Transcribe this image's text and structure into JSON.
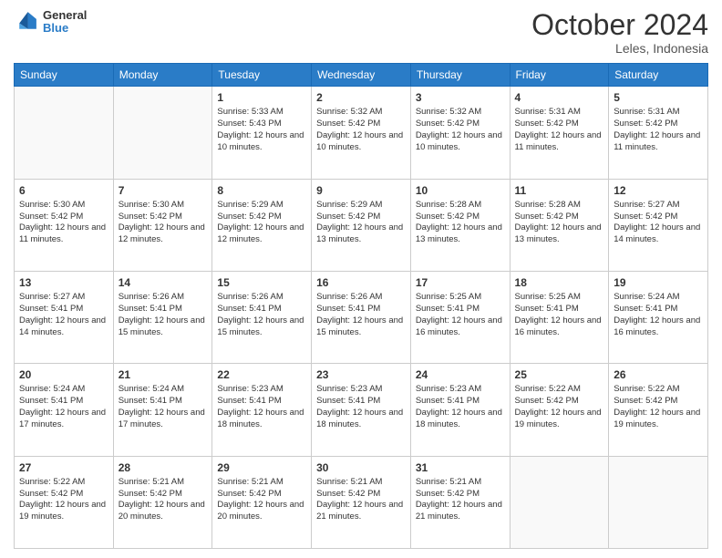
{
  "header": {
    "logo_line1": "General",
    "logo_line2": "Blue",
    "title": "October 2024",
    "subtitle": "Leles, Indonesia"
  },
  "days_of_week": [
    "Sunday",
    "Monday",
    "Tuesday",
    "Wednesday",
    "Thursday",
    "Friday",
    "Saturday"
  ],
  "weeks": [
    [
      {
        "day": "",
        "info": ""
      },
      {
        "day": "",
        "info": ""
      },
      {
        "day": "1",
        "info": "Sunrise: 5:33 AM\nSunset: 5:43 PM\nDaylight: 12 hours and 10 minutes."
      },
      {
        "day": "2",
        "info": "Sunrise: 5:32 AM\nSunset: 5:42 PM\nDaylight: 12 hours and 10 minutes."
      },
      {
        "day": "3",
        "info": "Sunrise: 5:32 AM\nSunset: 5:42 PM\nDaylight: 12 hours and 10 minutes."
      },
      {
        "day": "4",
        "info": "Sunrise: 5:31 AM\nSunset: 5:42 PM\nDaylight: 12 hours and 11 minutes."
      },
      {
        "day": "5",
        "info": "Sunrise: 5:31 AM\nSunset: 5:42 PM\nDaylight: 12 hours and 11 minutes."
      }
    ],
    [
      {
        "day": "6",
        "info": "Sunrise: 5:30 AM\nSunset: 5:42 PM\nDaylight: 12 hours and 11 minutes."
      },
      {
        "day": "7",
        "info": "Sunrise: 5:30 AM\nSunset: 5:42 PM\nDaylight: 12 hours and 12 minutes."
      },
      {
        "day": "8",
        "info": "Sunrise: 5:29 AM\nSunset: 5:42 PM\nDaylight: 12 hours and 12 minutes."
      },
      {
        "day": "9",
        "info": "Sunrise: 5:29 AM\nSunset: 5:42 PM\nDaylight: 12 hours and 13 minutes."
      },
      {
        "day": "10",
        "info": "Sunrise: 5:28 AM\nSunset: 5:42 PM\nDaylight: 12 hours and 13 minutes."
      },
      {
        "day": "11",
        "info": "Sunrise: 5:28 AM\nSunset: 5:42 PM\nDaylight: 12 hours and 13 minutes."
      },
      {
        "day": "12",
        "info": "Sunrise: 5:27 AM\nSunset: 5:42 PM\nDaylight: 12 hours and 14 minutes."
      }
    ],
    [
      {
        "day": "13",
        "info": "Sunrise: 5:27 AM\nSunset: 5:41 PM\nDaylight: 12 hours and 14 minutes."
      },
      {
        "day": "14",
        "info": "Sunrise: 5:26 AM\nSunset: 5:41 PM\nDaylight: 12 hours and 15 minutes."
      },
      {
        "day": "15",
        "info": "Sunrise: 5:26 AM\nSunset: 5:41 PM\nDaylight: 12 hours and 15 minutes."
      },
      {
        "day": "16",
        "info": "Sunrise: 5:26 AM\nSunset: 5:41 PM\nDaylight: 12 hours and 15 minutes."
      },
      {
        "day": "17",
        "info": "Sunrise: 5:25 AM\nSunset: 5:41 PM\nDaylight: 12 hours and 16 minutes."
      },
      {
        "day": "18",
        "info": "Sunrise: 5:25 AM\nSunset: 5:41 PM\nDaylight: 12 hours and 16 minutes."
      },
      {
        "day": "19",
        "info": "Sunrise: 5:24 AM\nSunset: 5:41 PM\nDaylight: 12 hours and 16 minutes."
      }
    ],
    [
      {
        "day": "20",
        "info": "Sunrise: 5:24 AM\nSunset: 5:41 PM\nDaylight: 12 hours and 17 minutes."
      },
      {
        "day": "21",
        "info": "Sunrise: 5:24 AM\nSunset: 5:41 PM\nDaylight: 12 hours and 17 minutes."
      },
      {
        "day": "22",
        "info": "Sunrise: 5:23 AM\nSunset: 5:41 PM\nDaylight: 12 hours and 18 minutes."
      },
      {
        "day": "23",
        "info": "Sunrise: 5:23 AM\nSunset: 5:41 PM\nDaylight: 12 hours and 18 minutes."
      },
      {
        "day": "24",
        "info": "Sunrise: 5:23 AM\nSunset: 5:41 PM\nDaylight: 12 hours and 18 minutes."
      },
      {
        "day": "25",
        "info": "Sunrise: 5:22 AM\nSunset: 5:42 PM\nDaylight: 12 hours and 19 minutes."
      },
      {
        "day": "26",
        "info": "Sunrise: 5:22 AM\nSunset: 5:42 PM\nDaylight: 12 hours and 19 minutes."
      }
    ],
    [
      {
        "day": "27",
        "info": "Sunrise: 5:22 AM\nSunset: 5:42 PM\nDaylight: 12 hours and 19 minutes."
      },
      {
        "day": "28",
        "info": "Sunrise: 5:21 AM\nSunset: 5:42 PM\nDaylight: 12 hours and 20 minutes."
      },
      {
        "day": "29",
        "info": "Sunrise: 5:21 AM\nSunset: 5:42 PM\nDaylight: 12 hours and 20 minutes."
      },
      {
        "day": "30",
        "info": "Sunrise: 5:21 AM\nSunset: 5:42 PM\nDaylight: 12 hours and 21 minutes."
      },
      {
        "day": "31",
        "info": "Sunrise: 5:21 AM\nSunset: 5:42 PM\nDaylight: 12 hours and 21 minutes."
      },
      {
        "day": "",
        "info": ""
      },
      {
        "day": "",
        "info": ""
      }
    ]
  ]
}
